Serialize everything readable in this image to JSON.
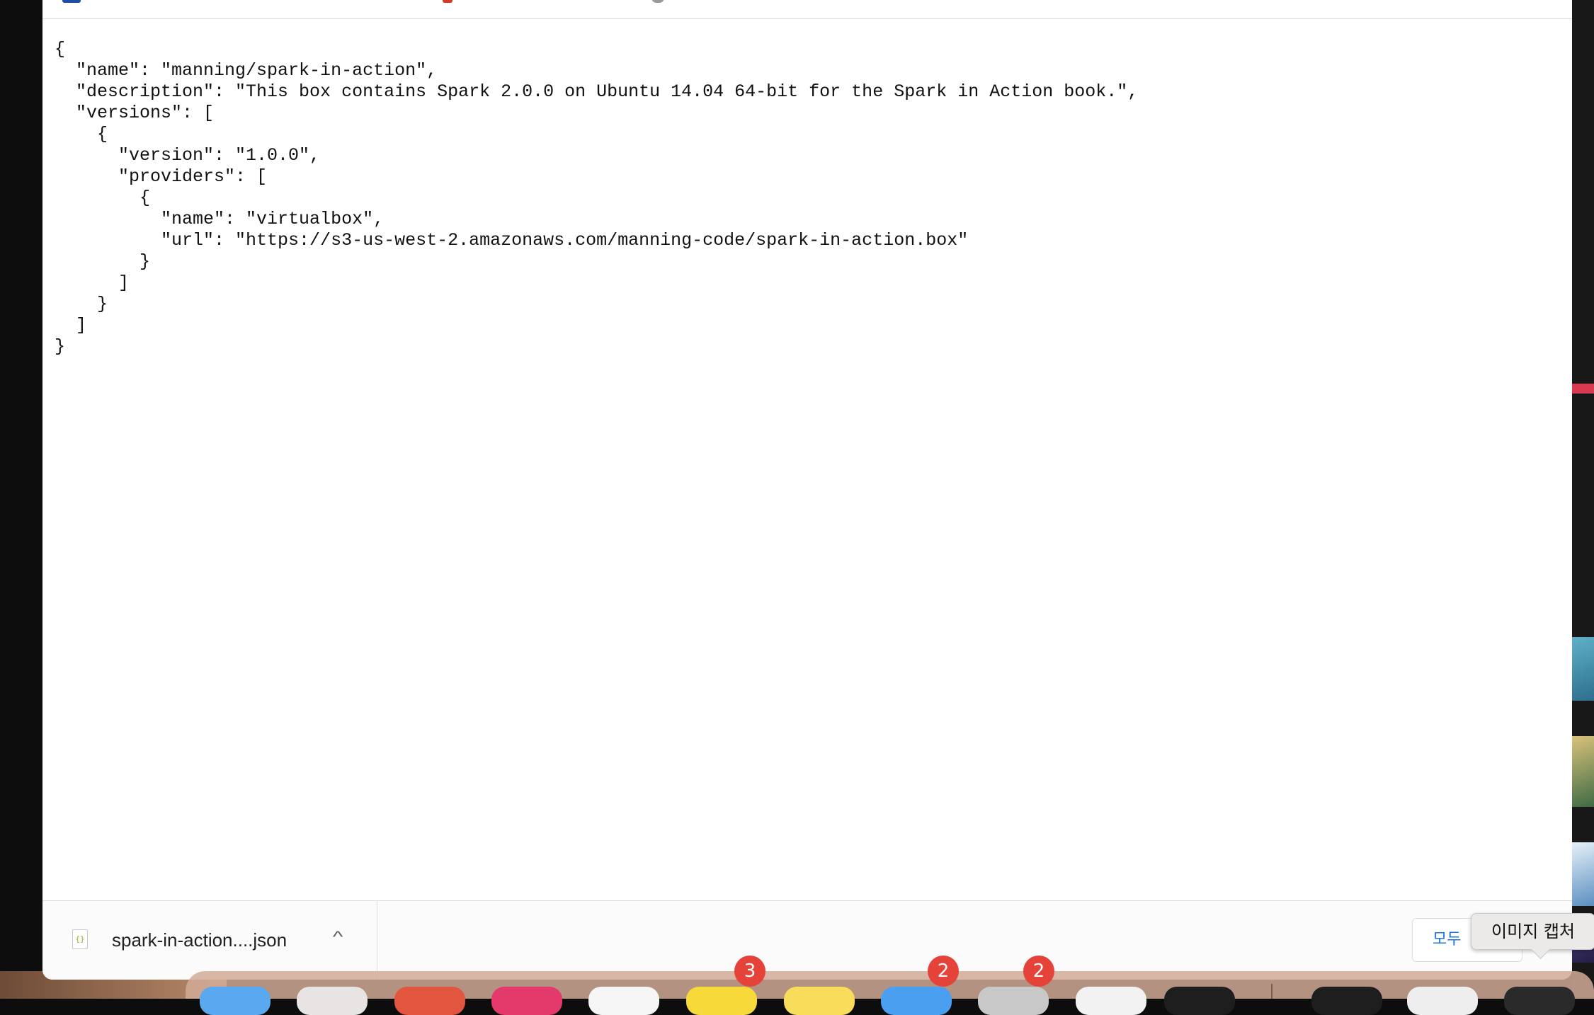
{
  "document": {
    "lines": [
      "{",
      "  \"name\": \"manning/spark-in-action\",",
      "  \"description\": \"This box contains Spark 2.0.0 on Ubuntu 14.04 64-bit for the Spark in Action book.\",",
      "  \"versions\": [",
      "    {",
      "      \"version\": \"1.0.0\",",
      "      \"providers\": [",
      "        {",
      "          \"name\": \"virtualbox\",",
      "          \"url\": \"https://s3-us-west-2.amazonaws.com/manning-code/spark-in-action.box\"",
      "        }",
      "      ]",
      "    }",
      "  ]",
      "}"
    ]
  },
  "download_bar": {
    "file_name": "spark-in-action....json",
    "file_icon": "json-file-icon",
    "file_icon_glyph": "{}",
    "chevron_icon": "chevron-up-icon",
    "chevron_glyph": "^",
    "show_all_label": "모두"
  },
  "tooltip": {
    "text": "이미지 캡처"
  },
  "dock": {
    "badges": [
      "3",
      "2",
      "2"
    ],
    "icons": [
      {
        "name": "finder-icon",
        "color": "#5aa8f0"
      },
      {
        "name": "launchpad-icon",
        "color": "#e9e4e4"
      },
      {
        "name": "chrome-icon",
        "color": "#e2553e"
      },
      {
        "name": "music-icon",
        "color": "#e33a6b"
      },
      {
        "name": "safari-icon",
        "color": "#f5f5f5"
      },
      {
        "name": "kakaotalk-icon",
        "color": "#f7d93a"
      },
      {
        "name": "notes-icon",
        "color": "#f8dc5a"
      },
      {
        "name": "appstore-icon",
        "color": "#4a9ff0"
      },
      {
        "name": "settings-icon",
        "color": "#c8c8c8"
      },
      {
        "name": "preview-icon",
        "color": "#f2f2f2"
      },
      {
        "name": "terminal-icon",
        "color": "#1e1e1e"
      },
      {
        "name": "screenshot-icon",
        "color": "#1e1e1e"
      },
      {
        "name": "downloads-icon",
        "color": "#eeeeee"
      },
      {
        "name": "trash-icon",
        "color": "#2a2a2a"
      }
    ]
  }
}
